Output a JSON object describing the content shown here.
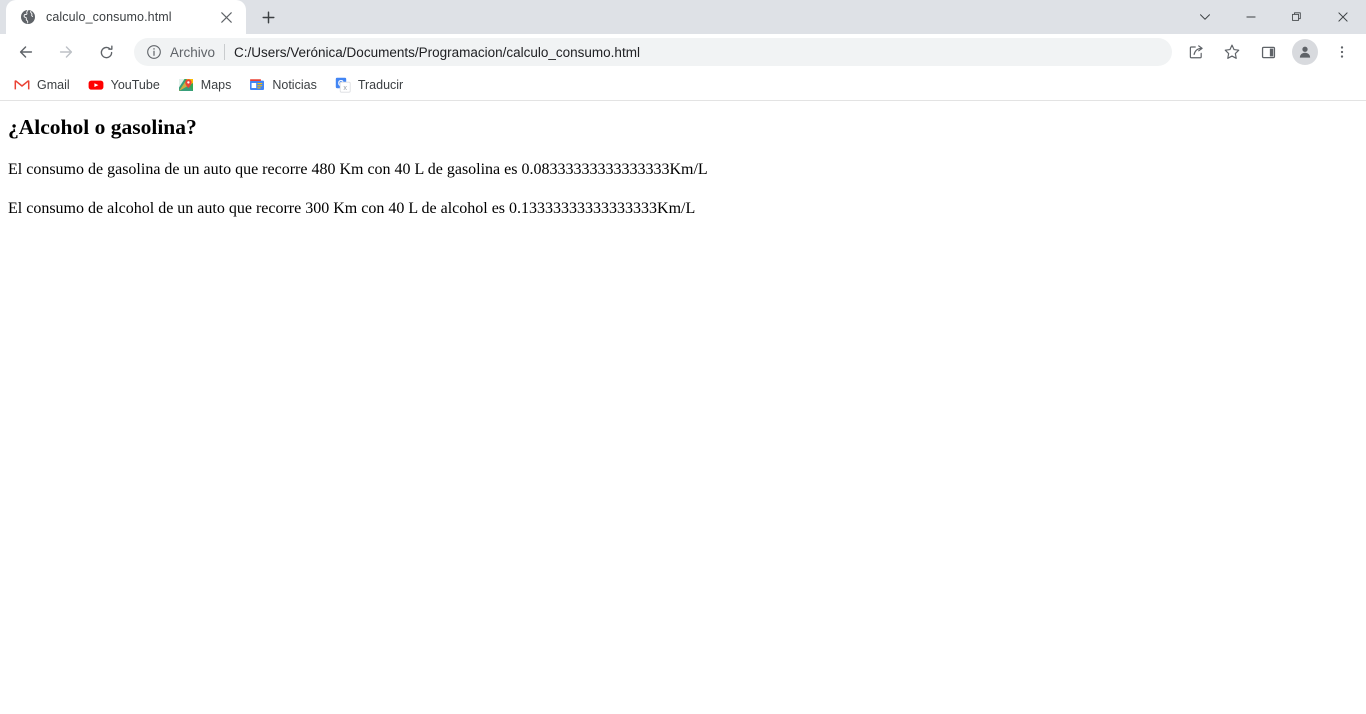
{
  "window": {
    "controls": [
      {
        "name": "tab-search",
        "glyph": "∨"
      },
      {
        "name": "minimize",
        "glyph": "—"
      },
      {
        "name": "maximize",
        "glyph": "❐"
      },
      {
        "name": "close",
        "glyph": "✕"
      }
    ]
  },
  "tabstrip": {
    "tab": {
      "title": "calculo_consumo.html",
      "favicon": "globe-icon",
      "close_label": "✕"
    },
    "new_tab_label": "+"
  },
  "toolbar": {
    "back_label": "←",
    "forward_label": "→",
    "reload_label": "⟳",
    "omnibox": {
      "info_icon": "info-circle-icon",
      "scheme_label": "Archivo",
      "url": "C:/Users/Verónica/Documents/Programacion/calculo_consumo.html"
    },
    "share_label": "share-icon",
    "bookmark_star_label": "star-icon",
    "side_panel_label": "side-panel-icon",
    "profile_label": "profile-avatar-icon",
    "menu_label": "⋮"
  },
  "bookmarks": [
    {
      "label": "Gmail",
      "icon": "gmail-icon"
    },
    {
      "label": "YouTube",
      "icon": "youtube-icon"
    },
    {
      "label": "Maps",
      "icon": "maps-icon"
    },
    {
      "label": "Noticias",
      "icon": "news-icon"
    },
    {
      "label": "Traducir",
      "icon": "translate-icon"
    }
  ],
  "page": {
    "heading": "¿Alcohol o gasolina?",
    "paragraph_1": "El consumo de gasolina de un auto que recorre 480 Km con 40 L de gasolina es 0.08333333333333333Km/L",
    "paragraph_2": "El consumo de alcohol de un auto que recorre 300 Km con 40 L de alcohol es 0.13333333333333333Km/L"
  },
  "colors": {
    "tabstrip_bg": "#dee1e6",
    "toolbar_bg": "#ffffff",
    "omnibox_bg": "#f1f3f4",
    "text_primary": "#202124",
    "text_secondary": "#5f6368"
  }
}
